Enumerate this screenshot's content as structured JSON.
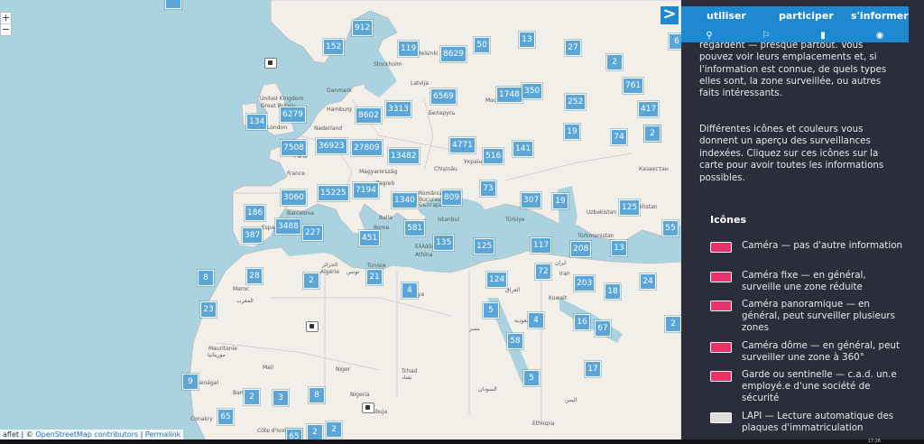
{
  "map": {
    "zoom_in": "+",
    "zoom_out": "−",
    "attribution": {
      "leaflet": "aflet",
      "sep1": " | © ",
      "osm": "OpenStreetMap contributors",
      "sep2": " | ",
      "permalink": "Permalink"
    },
    "clusters": [
      "912",
      "152",
      "119",
      "8629",
      "50",
      "13",
      "27",
      "6",
      "2",
      "761",
      "134",
      "6279",
      "8602",
      "3313",
      "6569",
      "1748",
      "350",
      "252",
      "417",
      "2",
      "7508",
      "36923",
      "27809",
      "13482",
      "4771",
      "516",
      "141",
      "19",
      "74",
      "2",
      "3060",
      "15225",
      "7194",
      "1340",
      "809",
      "73",
      "307",
      "19",
      "125",
      "186",
      "3488",
      "227",
      "451",
      "581",
      "135",
      "125",
      "117",
      "208",
      "13",
      "55",
      "387",
      "28",
      "8",
      "2",
      "21",
      "4",
      "124",
      "72",
      "203",
      "18",
      "24",
      "23",
      "5",
      "4",
      "16",
      "67",
      "2",
      "58",
      "5",
      "17",
      "9",
      "2",
      "3",
      "8",
      "2",
      "65",
      "2",
      "2",
      "65"
    ],
    "labels": [
      "Stockholm",
      "Helsinki",
      "Danmark",
      "Latvija",
      "United Kingdom",
      "Great Britain",
      "Hamburg",
      "Беларусь",
      "Москва",
      "London",
      "Nederland",
      "Paris",
      "France",
      "Україна",
      "Magyarország",
      "Chișinău",
      "Казахстан",
      "Zagreb",
      "România",
      "България",
      "București",
      "Barcelona",
      "España",
      "Italia",
      "Roma",
      "İstanbul",
      "Türkiye",
      "Ελλάδα",
      "Athína",
      "Algérie",
      "الجزائر",
      "Tunisie",
      "تونس",
      "Maroc",
      "المغرب",
      "Libya",
      "Mali",
      "Niger",
      "Tchad",
      "تشاد",
      "Nigeria",
      "Bamako",
      "Mauritanie",
      "موريتانيا",
      "Sénégal",
      "Abuja",
      "Conakry",
      "Côte d'Ivoire",
      "السودان",
      "مصر",
      "Kazakhstan",
      "Uzbekistan",
      "Türkmenistan",
      "Iran",
      "ایران",
      "العراق",
      "السعودية",
      "Kuwait",
      "اليمن",
      "Ethiopia"
    ]
  },
  "panel": {
    "nav": [
      "utiliser",
      "participer",
      "s'informer"
    ],
    "collapse": ">",
    "intro_top": "Surveillance under Surveillance vous montre les caméras et gardes — qui vous regardent — presque partout. Vous pouvez voir leurs emplacements et, si l'information est connue, de quels types elles sont, la zone surveillée, ou autres faits intéressants.",
    "intro_2": "Différentes icônes et couleurs vous donnent un aperçu des surveillances indexées. Cliquez sur ces icônes sur la carte pour avoir toutes les informations possibles.",
    "legend_title": "Icônes",
    "legend": [
      {
        "text": "Caméra — pas d'autre information",
        "color": "#e8336a"
      },
      {
        "text": "Caméra fixe — en général, surveille une zone réduite",
        "color": "#e8336a"
      },
      {
        "text": "Caméra panoramique — en général, peut surveiller plusieurs zones",
        "color": "#e8336a"
      },
      {
        "text": "Caméra dôme — en général, peut surveiller une zone à 360°",
        "color": "#e8336a"
      },
      {
        "text": "Garde ou sentinelle — c.a.d. un.e employé.e d'une société de sécurité",
        "color": "#e8336a"
      },
      {
        "text": "LAPI — Lecture automatique des plaques d'immatriculation",
        "color": "#dddddd"
      }
    ],
    "accent": "#1e88d1"
  },
  "taskbar": {
    "clock": "17:26"
  }
}
